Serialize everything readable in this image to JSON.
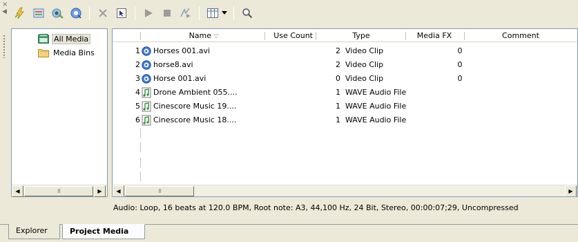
{
  "toolbar": {
    "icons": [
      "auto-preview-icon",
      "import-media-icon",
      "capture-video-icon",
      "get-media-from-web-icon",
      "remove-icon",
      "properties-icon",
      "play-icon",
      "stop-icon",
      "auto-preview-toggle-icon",
      "views-icon",
      "views-dropdown-icon",
      "search-icon"
    ]
  },
  "tree": {
    "items": [
      {
        "label": "All Media",
        "selected": true
      },
      {
        "label": "Media Bins",
        "selected": false
      }
    ]
  },
  "list": {
    "columns": [
      "Name",
      "Use Count",
      "Type",
      "Media FX",
      "Comment"
    ],
    "sort_indicator": "▽",
    "rows": [
      {
        "num": "1",
        "name": "Horses 001.avi",
        "use_count": "2",
        "type": "Video Clip",
        "media_fx": "0",
        "kind": "video"
      },
      {
        "num": "2",
        "name": "horse8.avi",
        "use_count": "2",
        "type": "Video Clip",
        "media_fx": "0",
        "kind": "video"
      },
      {
        "num": "3",
        "name": "Horse 001.avi",
        "use_count": "0",
        "type": "Video Clip",
        "media_fx": "0",
        "kind": "video"
      },
      {
        "num": "4",
        "name": "Drone Ambient 055....",
        "use_count": "1",
        "type": "WAVE Audio File",
        "media_fx": "",
        "kind": "audio"
      },
      {
        "num": "5",
        "name": "Cinescore Music 19....",
        "use_count": "1",
        "type": "WAVE Audio File",
        "media_fx": "",
        "kind": "audio"
      },
      {
        "num": "6",
        "name": "Cinescore Music 18....",
        "use_count": "1",
        "type": "WAVE Audio File",
        "media_fx": "",
        "kind": "audio"
      }
    ]
  },
  "status": "Audio: Loop, 16 beats at 120.0 BPM, Root note: A3, 44,100 Hz, 24 Bit, Stereo, 00:00:07;29, Uncompressed",
  "tabs": [
    {
      "label": "Explorer",
      "active": false
    },
    {
      "label": "Project Media",
      "active": true
    }
  ],
  "scroll": {
    "thumb_grip": "III"
  }
}
